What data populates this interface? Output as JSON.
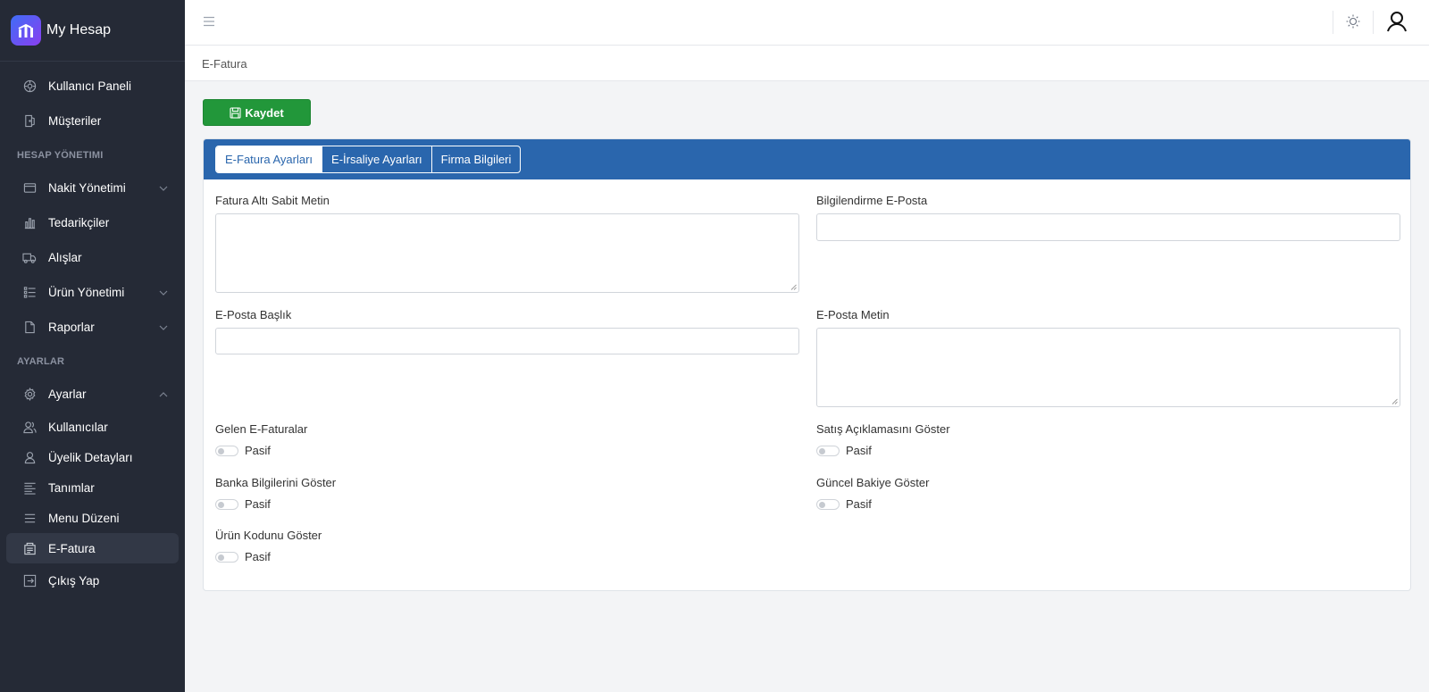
{
  "app": {
    "name": "My Hesap"
  },
  "sidebar": {
    "items_top": [
      {
        "label": "Kullanıcı Paneli",
        "icon": "dashboard-icon"
      },
      {
        "label": "Müşteriler",
        "icon": "door-icon"
      }
    ],
    "section1": "HESAP YÖNETIMI",
    "items_mid": [
      {
        "label": "Nakit Yönetimi",
        "icon": "wallet-icon",
        "expandable": true
      },
      {
        "label": "Tedarikçiler",
        "icon": "bar-chart-icon"
      },
      {
        "label": "Alışlar",
        "icon": "truck-icon"
      },
      {
        "label": "Ürün Yönetimi",
        "icon": "list-icon",
        "expandable": true
      },
      {
        "label": "Raporlar",
        "icon": "file-icon",
        "expandable": true
      }
    ],
    "section2": "AYARLAR",
    "items_bottom": [
      {
        "label": "Ayarlar",
        "icon": "gear-icon",
        "expanded": true
      },
      {
        "label": "Kullanıcılar",
        "icon": "users-icon"
      },
      {
        "label": "Üyelik Detayları",
        "icon": "user-icon"
      },
      {
        "label": "Tanımlar",
        "icon": "lines-icon"
      },
      {
        "label": "Menu Düzeni",
        "icon": "menu-icon"
      },
      {
        "label": "E-Fatura",
        "icon": "invoice-icon",
        "active": true
      },
      {
        "label": "Çıkış Yap",
        "icon": "logout-icon"
      }
    ]
  },
  "breadcrumb": "E-Fatura",
  "toolbar": {
    "save_label": "Kaydet"
  },
  "tabs": [
    {
      "label": "E-Fatura Ayarları",
      "active": true
    },
    {
      "label": "E-İrsaliye Ayarları",
      "active": false
    },
    {
      "label": "Firma Bilgileri",
      "active": false
    }
  ],
  "form": {
    "footer_text_label": "Fatura Altı Sabit Metin",
    "footer_text_value": "",
    "notify_email_label": "Bilgilendirme E-Posta",
    "notify_email_value": "",
    "email_subject_label": "E-Posta Başlık",
    "email_subject_value": "",
    "email_body_label": "E-Posta Metin",
    "email_body_value": "",
    "toggles": [
      {
        "label": "Gelen E-Faturalar",
        "state": "Pasif",
        "on": false
      },
      {
        "label": "Satış Açıklamasını Göster",
        "state": "Pasif",
        "on": false
      },
      {
        "label": "Banka Bilgilerini Göster",
        "state": "Pasif",
        "on": false
      },
      {
        "label": "Güncel Bakiye Göster",
        "state": "Pasif",
        "on": false
      },
      {
        "label": "Ürün Kodunu Göster",
        "state": "Pasif",
        "on": false
      }
    ]
  },
  "colors": {
    "sidebar": "#252a36",
    "accent": "#2a66ad",
    "save": "#22973a"
  }
}
